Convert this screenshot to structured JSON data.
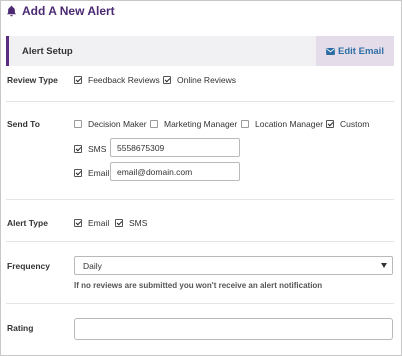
{
  "header": {
    "title": "Add A New Alert",
    "icon": "bell-icon",
    "accent_color": "#4b2a73"
  },
  "setup": {
    "title": "Alert Setup",
    "edit_label": "Edit Email",
    "edit_icon": "envelope-icon"
  },
  "review_type": {
    "label": "Review Type",
    "options": [
      {
        "label": "Feedback Reviews",
        "checked": true
      },
      {
        "label": "Online Reviews",
        "checked": true
      }
    ]
  },
  "send_to": {
    "label": "Send To",
    "options": [
      {
        "label": "Decision Maker",
        "checked": false
      },
      {
        "label": "Marketing Manager",
        "checked": false
      },
      {
        "label": "Location Manager",
        "checked": false
      },
      {
        "label": "Custom",
        "checked": true
      }
    ],
    "sms": {
      "label": "SMS",
      "checked": true,
      "value": "5558675309"
    },
    "email": {
      "label": "Email",
      "checked": true,
      "value": "email@domain.com"
    }
  },
  "alert_type": {
    "label": "Alert Type",
    "options": [
      {
        "label": "Email",
        "checked": true
      },
      {
        "label": "SMS",
        "checked": true
      }
    ]
  },
  "frequency": {
    "label": "Frequency",
    "selected": "Daily",
    "hint": "If no reviews are submitted you won't receive an alert notification"
  },
  "rating": {
    "label": "Rating",
    "value": ""
  }
}
